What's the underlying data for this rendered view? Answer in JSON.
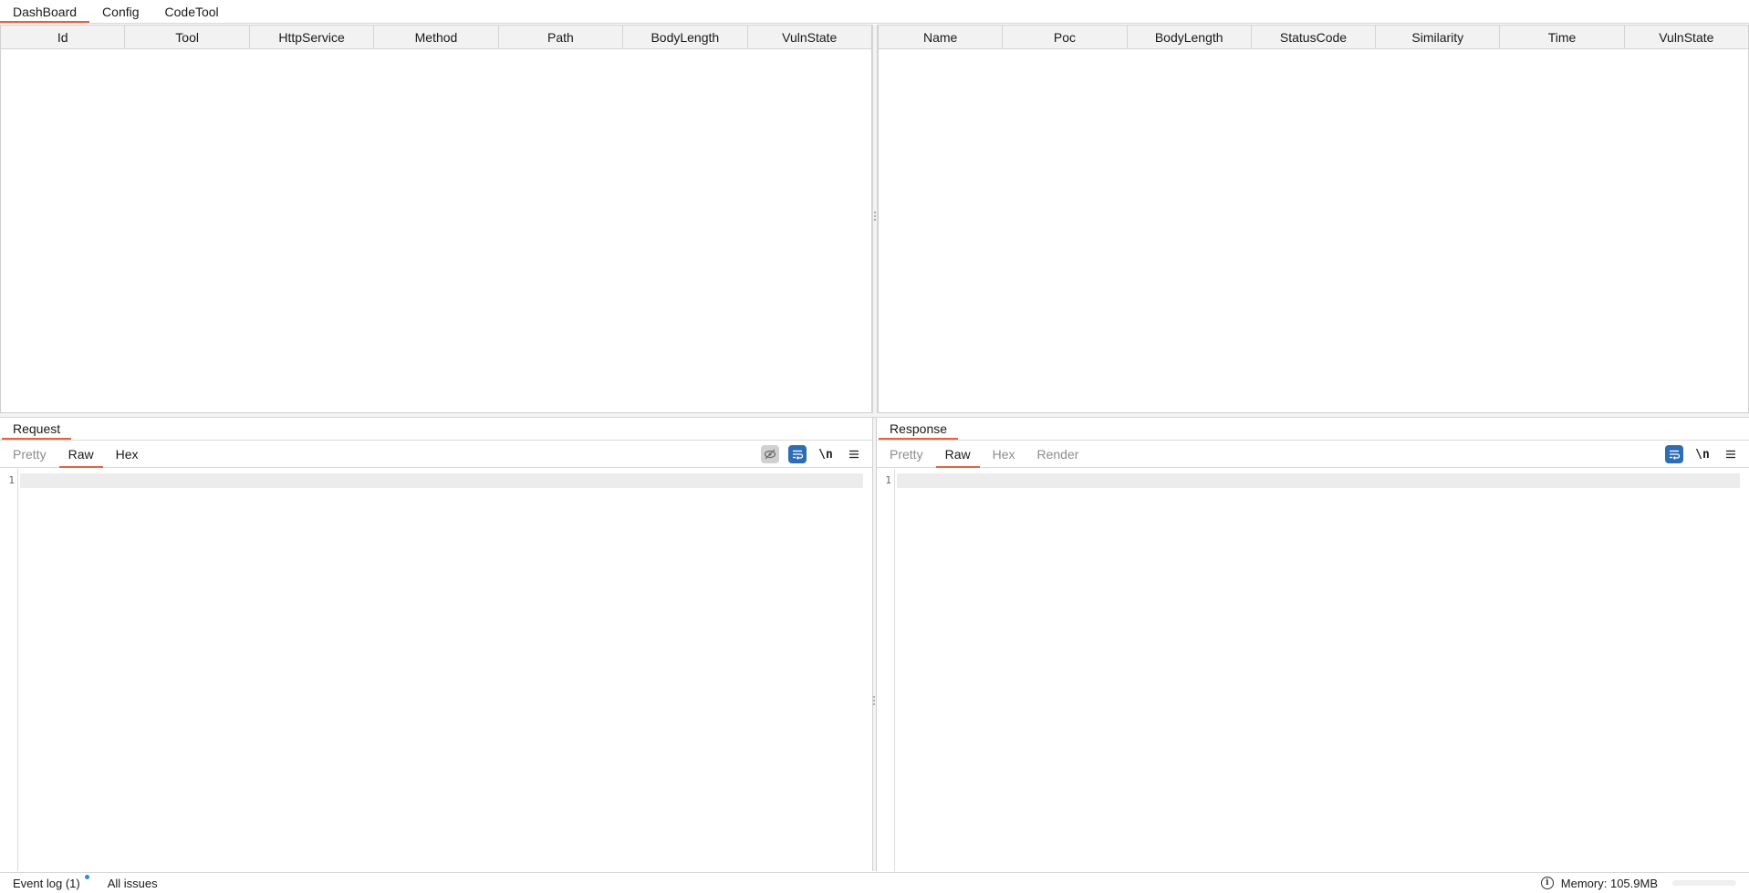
{
  "top_tabs": [
    {
      "label": "DashBoard",
      "active": true
    },
    {
      "label": "Config",
      "active": false
    },
    {
      "label": "CodeTool",
      "active": false
    }
  ],
  "left_table": {
    "columns": [
      "Id",
      "Tool",
      "HttpService",
      "Method",
      "Path",
      "BodyLength",
      "VulnState"
    ],
    "rows": []
  },
  "right_table": {
    "columns": [
      "Name",
      "Poc",
      "BodyLength",
      "StatusCode",
      "Similarity",
      "Time",
      "VulnState"
    ],
    "rows": []
  },
  "request_pane": {
    "title": "Request",
    "view_tabs": [
      "Pretty",
      "Raw",
      "Hex"
    ],
    "active_view": "Raw",
    "line_number": "1",
    "tools": {
      "hide_icon": "eye-off-icon",
      "wrap_icon": "wrap-lines-icon",
      "newline_label": "\\n",
      "menu_icon": "hamburger-menu-icon"
    }
  },
  "response_pane": {
    "title": "Response",
    "view_tabs": [
      "Pretty",
      "Raw",
      "Hex",
      "Render"
    ],
    "active_view": "Raw",
    "line_number": "1",
    "tools": {
      "wrap_icon": "wrap-lines-icon",
      "newline_label": "\\n",
      "menu_icon": "hamburger-menu-icon"
    }
  },
  "status_bar": {
    "event_log": "Event log (1)",
    "all_issues": "All issues",
    "memory": "Memory: 105.9MB"
  },
  "colors": {
    "accent": "#e8623d",
    "button_blue": "#2f6db3",
    "notification": "#2a8ed8"
  }
}
